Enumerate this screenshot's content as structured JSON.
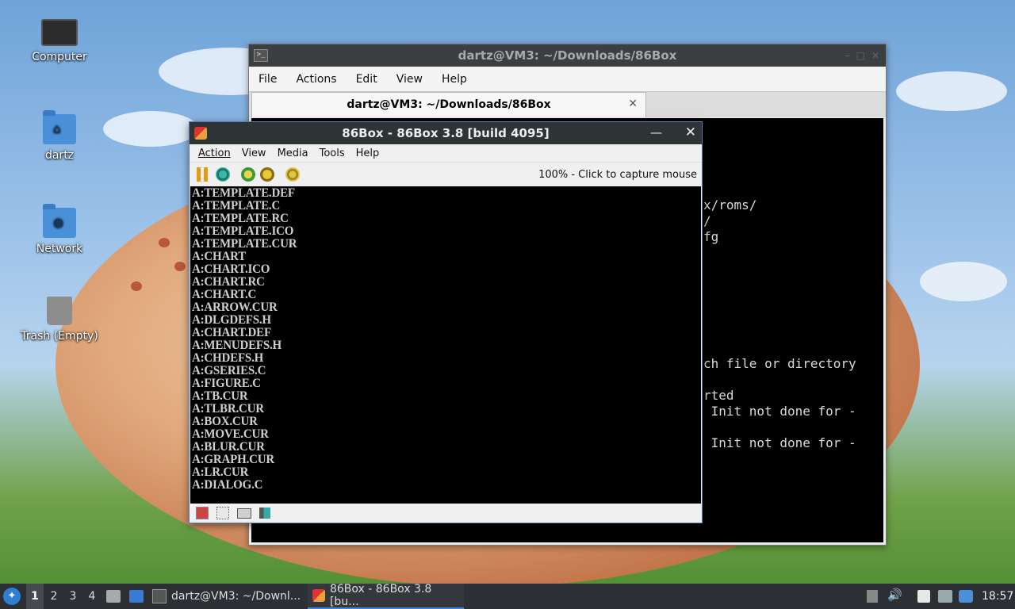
{
  "desktop": {
    "icons": [
      {
        "label": "Computer",
        "icon": "computer-icon"
      },
      {
        "label": "dartz",
        "icon": "home-folder-icon"
      },
      {
        "label": "Network",
        "icon": "network-folder-icon"
      },
      {
        "label": "Trash (Empty)",
        "icon": "trash-icon"
      }
    ]
  },
  "terminal": {
    "title": "dartz@VM3: ~/Downloads/86Box",
    "menu": [
      "File",
      "Actions",
      "Edit",
      "View",
      "Help"
    ],
    "tab_label": "dartz@VM3: ~/Downloads/86Box",
    "visible_lines": [
      "x/roms/",
      "/",
      "fg",
      "ch file or directory",
      "rted",
      " Init not done for -",
      " Init not done for -"
    ]
  },
  "box86": {
    "title": "86Box - 86Box 3.8 [build 4095]",
    "menu": [
      "Action",
      "View",
      "Media",
      "Tools",
      "Help"
    ],
    "toolbar_icons": [
      "pause-icon",
      "hard-reset-icon",
      "ctrl-alt-del-icon",
      "ctrl-alt-esc-icon",
      "settings-icon"
    ],
    "status_text": "100% - Click to capture mouse",
    "dos_lines": [
      "A:TEMPLATE.DEF",
      "A:TEMPLATE.C",
      "A:TEMPLATE.RC",
      "A:TEMPLATE.ICO",
      "A:TEMPLATE.CUR",
      "A:CHART",
      "A:CHART.ICO",
      "A:CHART.RC",
      "A:CHART.C",
      "A:ARROW.CUR",
      "A:DLGDEFS.H",
      "A:CHART.DEF",
      "A:MENUDEFS.H",
      "A:CHDEFS.H",
      "A:GSERIES.C",
      "A:FIGURE.C",
      "A:TB.CUR",
      "A:TLBR.CUR",
      "A:BOX.CUR",
      "A:MOVE.CUR",
      "A:BLUR.CUR",
      "A:GRAPH.CUR",
      "A:LR.CUR",
      "A:DIALOG.C"
    ],
    "statusbar_icons": [
      "floppy-icon",
      "floppy-empty-icon",
      "hard-disk-icon",
      "sound-icon"
    ]
  },
  "taskbar": {
    "workspaces": [
      "1",
      "2",
      "3",
      "4"
    ],
    "active_workspace": "1",
    "tasks": [
      {
        "label": "dartz@VM3: ~/Downl...",
        "icon": "terminal-icon"
      },
      {
        "label": "86Box - 86Box 3.8 [bu...",
        "icon": "86box-icon"
      }
    ],
    "clock": "18:57"
  }
}
